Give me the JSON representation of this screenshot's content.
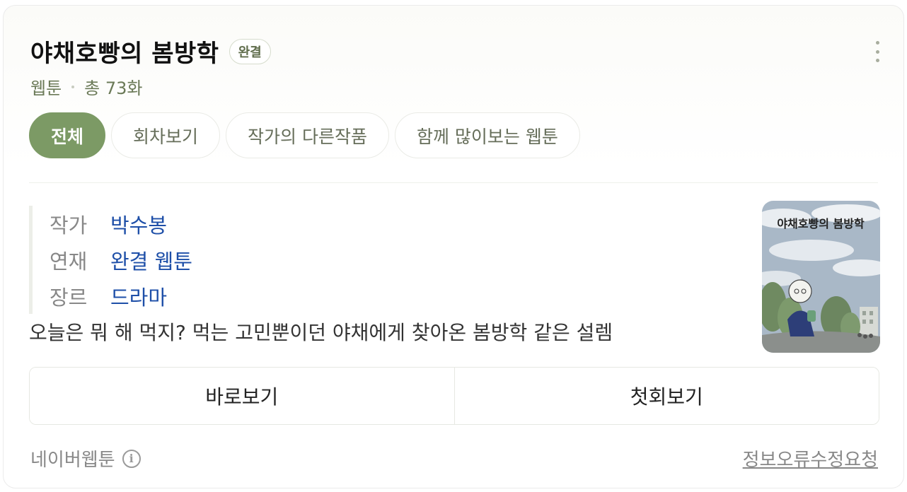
{
  "header": {
    "title": "야채호빵의 봄방학",
    "status_badge": "완결",
    "category": "웹툰",
    "episodes": "총 73화",
    "more_icon": "more-vertical-icon"
  },
  "tabs": [
    {
      "label": "전체",
      "active": true
    },
    {
      "label": "회차보기",
      "active": false
    },
    {
      "label": "작가의 다른작품",
      "active": false
    },
    {
      "label": "함께 많이보는 웹툰",
      "active": false
    }
  ],
  "info": [
    {
      "key": "작가",
      "value": "박수봉"
    },
    {
      "key": "연재",
      "value": "완결 웹툰"
    },
    {
      "key": "장르",
      "value": "드라마"
    }
  ],
  "description": "오늘은 뭐 해 먹지? 먹는 고민뿐이던 야채에게 찾아온 봄방학 같은 설렘",
  "thumbnail": {
    "title_text": "야채호빵의 봄방학"
  },
  "actions": {
    "read_now": "바로보기",
    "first_episode": "첫회보기"
  },
  "footer": {
    "source": "네이버웹툰",
    "info_icon": "info-icon",
    "report_link": "정보오류수정요청"
  },
  "colors": {
    "accent": "#7c9a65",
    "link": "#1e4fa8",
    "badge_text": "#5f6c4b"
  }
}
